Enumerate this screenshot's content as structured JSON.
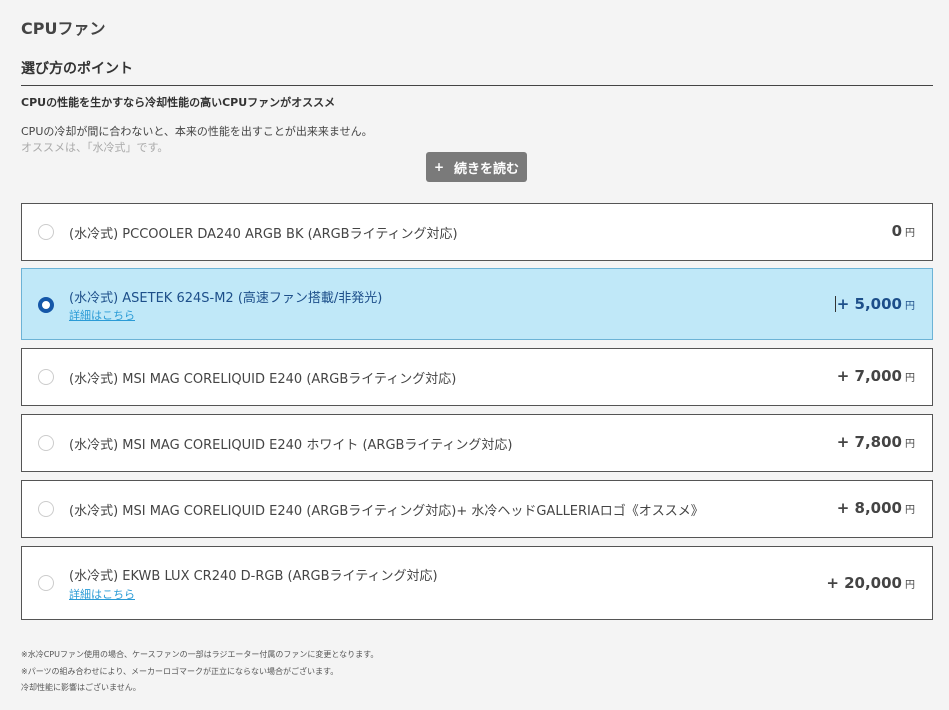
{
  "page_title": "CPUファン",
  "section_heading": "選び方のポイント",
  "lead": "CPUの性能を生かすなら冷却性能の高いCPUファンがオススメ",
  "description": [
    "CPUの冷却が間に合わないと、本来の性能を出すことが出来来ません。",
    "オススメは、「水冷式」です。"
  ],
  "read_more": {
    "icon": "+",
    "label": "続きを読む"
  },
  "options": [
    {
      "name": "(水冷式) PCCOOLER DA240 ARGB BK (ARGBライティング対応)",
      "price": "0",
      "unit": "円",
      "detail": ""
    },
    {
      "name": "(水冷式) ASETEK 624S-M2 (高速ファン搭載/非発光)",
      "price": "+ 5,000",
      "unit": "円",
      "detail": "詳細はこちら"
    },
    {
      "name": "(水冷式) MSI MAG CORELIQUID E240 (ARGBライティング対応)",
      "price": "+ 7,000",
      "unit": "円",
      "detail": ""
    },
    {
      "name": "(水冷式) MSI MAG CORELIQUID E240 ホワイト (ARGBライティング対応)",
      "price": "+ 7,800",
      "unit": "円",
      "detail": ""
    },
    {
      "name": "(水冷式) MSI MAG CORELIQUID E240 (ARGBライティング対応)+ 水冷ヘッドGALLERIAロゴ《オススメ》",
      "price": "+ 8,000",
      "unit": "円",
      "detail": ""
    },
    {
      "name": "(水冷式) EKWB LUX CR240 D-RGB (ARGBライティング対応)",
      "price": "+ 20,000",
      "unit": "円",
      "detail": "詳細はこちら"
    }
  ],
  "selected_index": 1,
  "notes": [
    "※水冷CPUファン使用の場合、ケースファンの一部はラジエーター付属のファンに変更となります。",
    "※パーツの組み合わせにより、メーカーロゴマークが正立にならない場合がございます。",
    "冷却性能に影響はございません。"
  ],
  "colors": {
    "selected_bg": "#c0e8f8",
    "selected_text": "#1d4f8a",
    "radio_selected": "#1557a8",
    "link": "#2a9bd6",
    "button_bg": "#7a7a7a"
  }
}
